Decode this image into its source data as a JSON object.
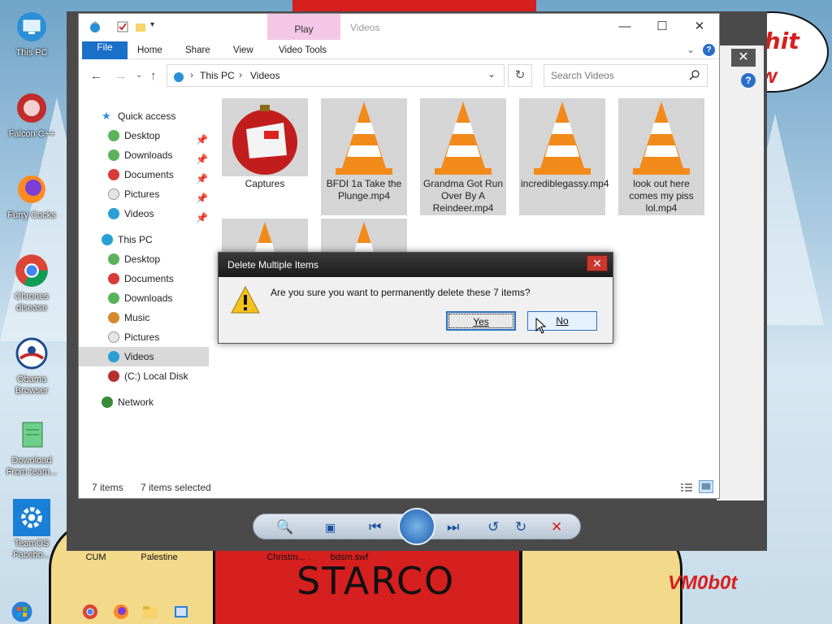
{
  "desktop": {
    "icons": [
      {
        "label": "This PC"
      },
      {
        "label": "Falcon C++"
      },
      {
        "label": "Furry Cocks"
      },
      {
        "label": "Chrones disease"
      },
      {
        "label": "Obama Browser"
      },
      {
        "label": "Download From team..."
      },
      {
        "label": "TeamOS Facebo..."
      }
    ],
    "bottom_labels": [
      "CUM",
      "Palestine",
      "Christm...",
      "bdsm.swf"
    ],
    "wallpaper_text": "STARCO",
    "wallpaper_tag": "VM0b0t",
    "bubble_text_1": "et shit",
    "bubble_text_2": "w"
  },
  "explorer": {
    "play_tab": "Play",
    "title": "Videos",
    "ribbon": {
      "file": "File",
      "home": "Home",
      "share": "Share",
      "view": "View",
      "video_tools": "Video Tools"
    },
    "address": {
      "seg1": "This PC",
      "seg2": "Videos"
    },
    "search_placeholder": "Search Videos",
    "nav": {
      "quick_access": "Quick access",
      "qa_items": [
        "Desktop",
        "Downloads",
        "Documents",
        "Pictures",
        "Videos"
      ],
      "this_pc": "This PC",
      "pc_items": [
        "Desktop",
        "Documents",
        "Downloads",
        "Music",
        "Pictures",
        "Videos",
        "(C:) Local Disk"
      ],
      "network": "Network"
    },
    "files": [
      {
        "name": "Captures"
      },
      {
        "name": "BFDI 1a Take the Plunge.mp4"
      },
      {
        "name": "Grandma Got Run Over By A Reindeer.mp4"
      },
      {
        "name": "incrediblegassy.mp4"
      },
      {
        "name": "look out here comes my piss lol.mp4"
      }
    ],
    "status": {
      "count": "7 items",
      "selected": "7 items selected"
    }
  },
  "dialog": {
    "title": "Delete Multiple Items",
    "message": "Are you sure you want to permanently delete these 7 items?",
    "yes": "Yes",
    "no": "No"
  }
}
